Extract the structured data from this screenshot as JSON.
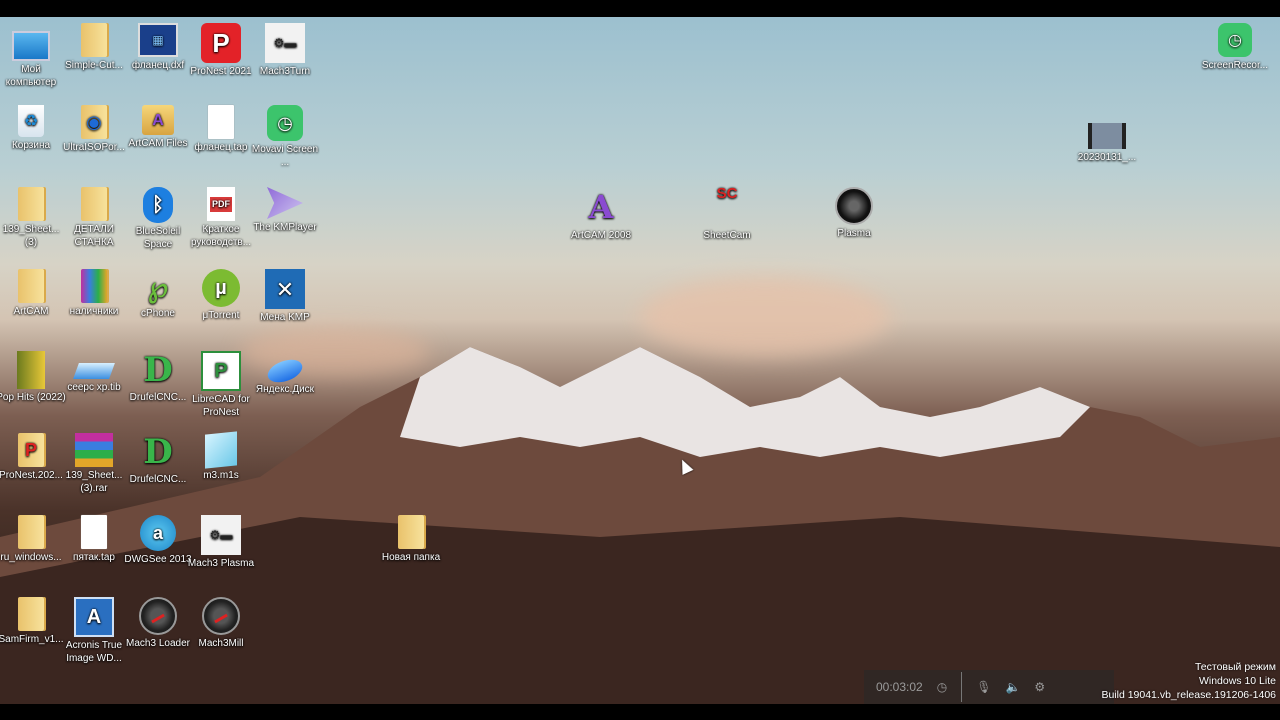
{
  "desktop": {
    "icons": [
      {
        "label": "Мой компьютер",
        "kind": "monitor-icon"
      },
      {
        "label": "Simple-Cut...",
        "kind": "folder-icon"
      },
      {
        "label": "фланец.dxf",
        "kind": "dxf-file-icon"
      },
      {
        "label": "ProNest 2021",
        "kind": "pronest-icon"
      },
      {
        "label": "Mach3Turn",
        "kind": "mach3-icon"
      },
      {
        "label": "Корзина",
        "kind": "recycle-bin-icon"
      },
      {
        "label": "UltraISOPor...",
        "kind": "ultraiso-folder-icon"
      },
      {
        "label": "ArtCAM Files",
        "kind": "folder-icon"
      },
      {
        "label": "фланец.tap",
        "kind": "document-icon"
      },
      {
        "label": "Movavi Screen ...",
        "kind": "movavi-icon"
      },
      {
        "label": "139_Sheet... (3)",
        "kind": "folder-icon"
      },
      {
        "label": "ДЕТАЛИ СТАНКА",
        "kind": "folder-icon"
      },
      {
        "label": "BlueSoleil Space",
        "kind": "bluetooth-icon"
      },
      {
        "label": "Краткое руководств...",
        "kind": "pdf-icon"
      },
      {
        "label": "The KMPlayer",
        "kind": "kmplayer-icon"
      },
      {
        "label": "ArtCAM",
        "kind": "folder-icon"
      },
      {
        "label": "наличники",
        "kind": "archive-folder-icon"
      },
      {
        "label": "cPhone",
        "kind": "cphone-icon"
      },
      {
        "label": "μTorrent",
        "kind": "utorrent-icon"
      },
      {
        "label": "Мена KMP",
        "kind": "kmp-icon"
      },
      {
        "label": "Pop Hits (2022)",
        "kind": "music-folder-icon"
      },
      {
        "label": "ceepc xp.tib",
        "kind": "disk-image-icon"
      },
      {
        "label": "DrufelCNC...",
        "kind": "drufelcnc-icon"
      },
      {
        "label": "LibreCAD for ProNest",
        "kind": "librecad-icon"
      },
      {
        "label": "Яндекс.Диск",
        "kind": "yandex-disk-icon"
      },
      {
        "label": "ProNest.202...",
        "kind": "pronest-folder-icon"
      },
      {
        "label": "139_Sheet... (3).rar",
        "kind": "winrar-icon"
      },
      {
        "label": "DrufelCNC...",
        "kind": "drufelcnc-icon"
      },
      {
        "label": "m3.m1s",
        "kind": "m1s-file-icon"
      },
      {
        "label": "ru_windows...",
        "kind": "folder-icon"
      },
      {
        "label": "пятак.tap",
        "kind": "document-icon"
      },
      {
        "label": "DWGSee 2013",
        "kind": "dwgsee-icon"
      },
      {
        "label": "Mach3 Plasma",
        "kind": "mach3-icon"
      },
      {
        "label": "Новая папка",
        "kind": "folder-icon"
      },
      {
        "label": "SamFirm_v1...",
        "kind": "folder-icon"
      },
      {
        "label": "Acronis True Image WD...",
        "kind": "acronis-icon"
      },
      {
        "label": "Mach3 Loader",
        "kind": "mach3-gauge-icon"
      },
      {
        "label": "Mach3Mill",
        "kind": "mach3-gauge-icon"
      },
      {
        "label": "ArtCAM 2008",
        "kind": "artcam-icon"
      },
      {
        "label": "SheetCam",
        "kind": "sheetcam-icon"
      },
      {
        "label": "Plasma",
        "kind": "plasma-icon"
      },
      {
        "label": "20230131_...",
        "kind": "video-file-icon"
      },
      {
        "label": "ScreenRecor...",
        "kind": "screen-recorder-icon"
      }
    ]
  },
  "recorder": {
    "timer": "00:03:02"
  },
  "watermark": {
    "line1": "Тестовый режим",
    "line2": "Windows 10 Lite",
    "line3": "Build 19041.vb_release.191206-1406"
  }
}
